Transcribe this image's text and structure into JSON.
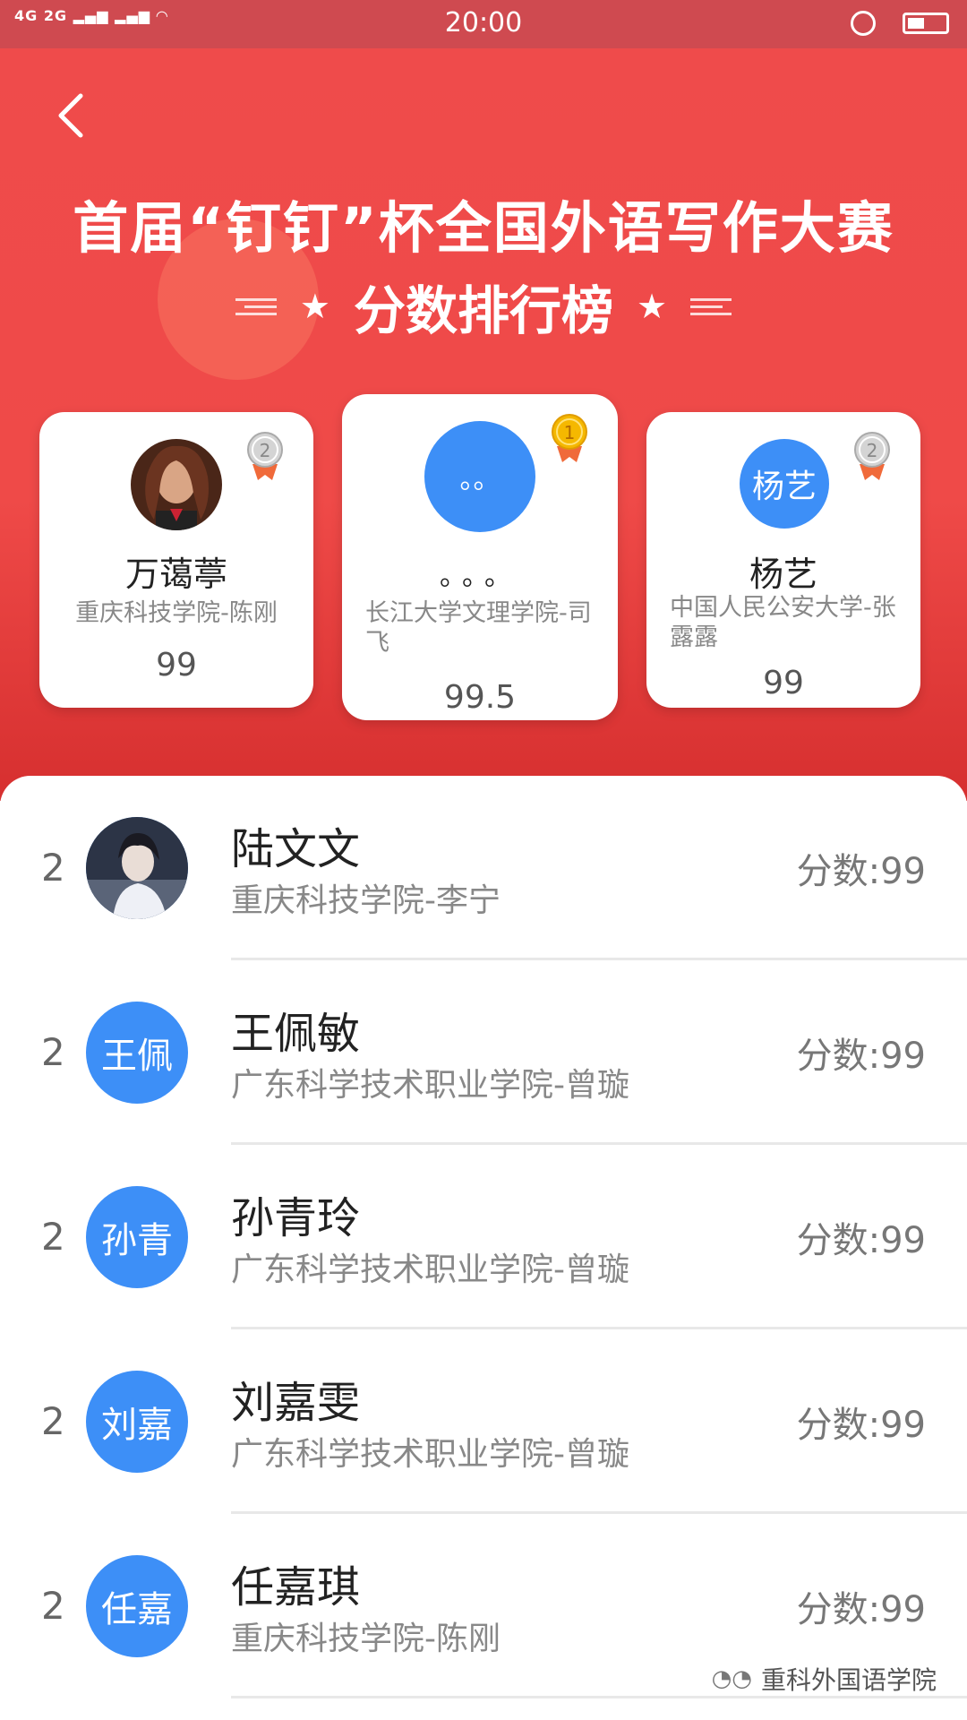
{
  "status_bar": {
    "network": "4G 2G",
    "time": "20:00"
  },
  "header": {
    "title": "首届“钉钉”杯全国外语写作大赛",
    "subtitle": "分数排行榜"
  },
  "podium": [
    {
      "rank_badge": "2",
      "avatar_type": "photo",
      "avatar_text": "",
      "name": "万蔼葶",
      "school": "重庆科技学院-陈刚",
      "score": "99"
    },
    {
      "rank_badge": "1",
      "avatar_type": "text",
      "avatar_text": "。。",
      "name": "。。。",
      "school": "长江大学文理学院-司飞",
      "score": "99.5"
    },
    {
      "rank_badge": "2",
      "avatar_type": "text",
      "avatar_text": "杨艺",
      "name": "杨艺",
      "school": "中国人民公安大学-张露露",
      "score": "99"
    }
  ],
  "list": [
    {
      "rank": "2",
      "avatar_type": "photo",
      "avatar_text": "",
      "name": "陆文文",
      "school": "重庆科技学院-李宁",
      "score": "分数:99"
    },
    {
      "rank": "2",
      "avatar_type": "text",
      "avatar_text": "王佩",
      "name": "王佩敏",
      "school": "广东科学技术职业学院-曾璇",
      "score": "分数:99"
    },
    {
      "rank": "2",
      "avatar_type": "text",
      "avatar_text": "孙青",
      "name": "孙青玲",
      "school": "广东科学技术职业学院-曾璇",
      "score": "分数:99"
    },
    {
      "rank": "2",
      "avatar_type": "text",
      "avatar_text": "刘嘉",
      "name": "刘嘉雯",
      "school": "广东科学技术职业学院-曾璇",
      "score": "分数:99"
    },
    {
      "rank": "2",
      "avatar_type": "text",
      "avatar_text": "任嘉",
      "name": "任嘉琪",
      "school": "重庆科技学院-陈刚",
      "score": "分数:99"
    }
  ],
  "watermark": "重科外国语学院",
  "colors": {
    "header_red": "#ef4a48",
    "avatar_blue": "#3d8ff7",
    "gold": "#f5b800",
    "silver": "#c9c9c9"
  }
}
